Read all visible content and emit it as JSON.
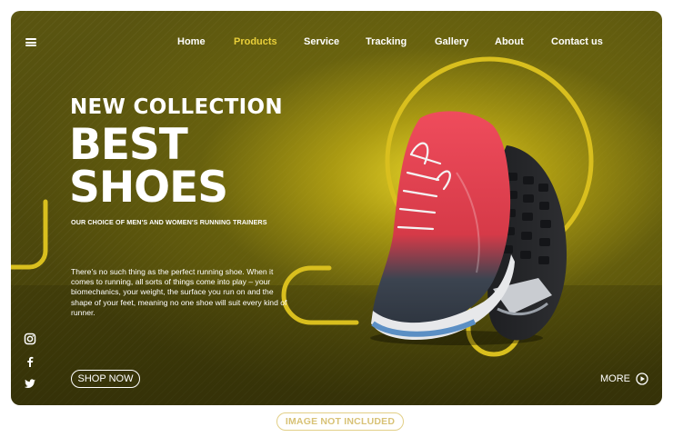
{
  "nav": {
    "items": [
      {
        "label": "Home",
        "active": false
      },
      {
        "label": "Products",
        "active": true
      },
      {
        "label": "Service",
        "active": false
      },
      {
        "label": "Tracking",
        "active": false
      },
      {
        "label": "Gallery",
        "active": false
      },
      {
        "label": "About",
        "active": false
      },
      {
        "label": "Contact us",
        "active": false
      }
    ]
  },
  "hero": {
    "kicker": "NEW COLLECTION",
    "headline_line1": "BEST",
    "headline_line2": "SHOES",
    "tagline": "OUR CHOICE OF MEN'S AND WOMEN'S RUNNING TRAINERS",
    "body": "There's no such thing as the perfect running shoe. When it comes to running, all sorts of things come into play – your biomechanics, your weight, the surface you run on and the shape of your feet, meaning no one shoe will suit every kind of runner."
  },
  "actions": {
    "shop_now": "SHOP NOW",
    "more": "MORE"
  },
  "social": {
    "icons": [
      "instagram-icon",
      "facebook-icon",
      "twitter-icon"
    ]
  },
  "footer_badge": "IMAGE NOT INCLUDED",
  "colors": {
    "background": "#4f4a0c",
    "accent": "#e9cf3a",
    "text": "#ffffff",
    "badge": "#d8c276"
  }
}
